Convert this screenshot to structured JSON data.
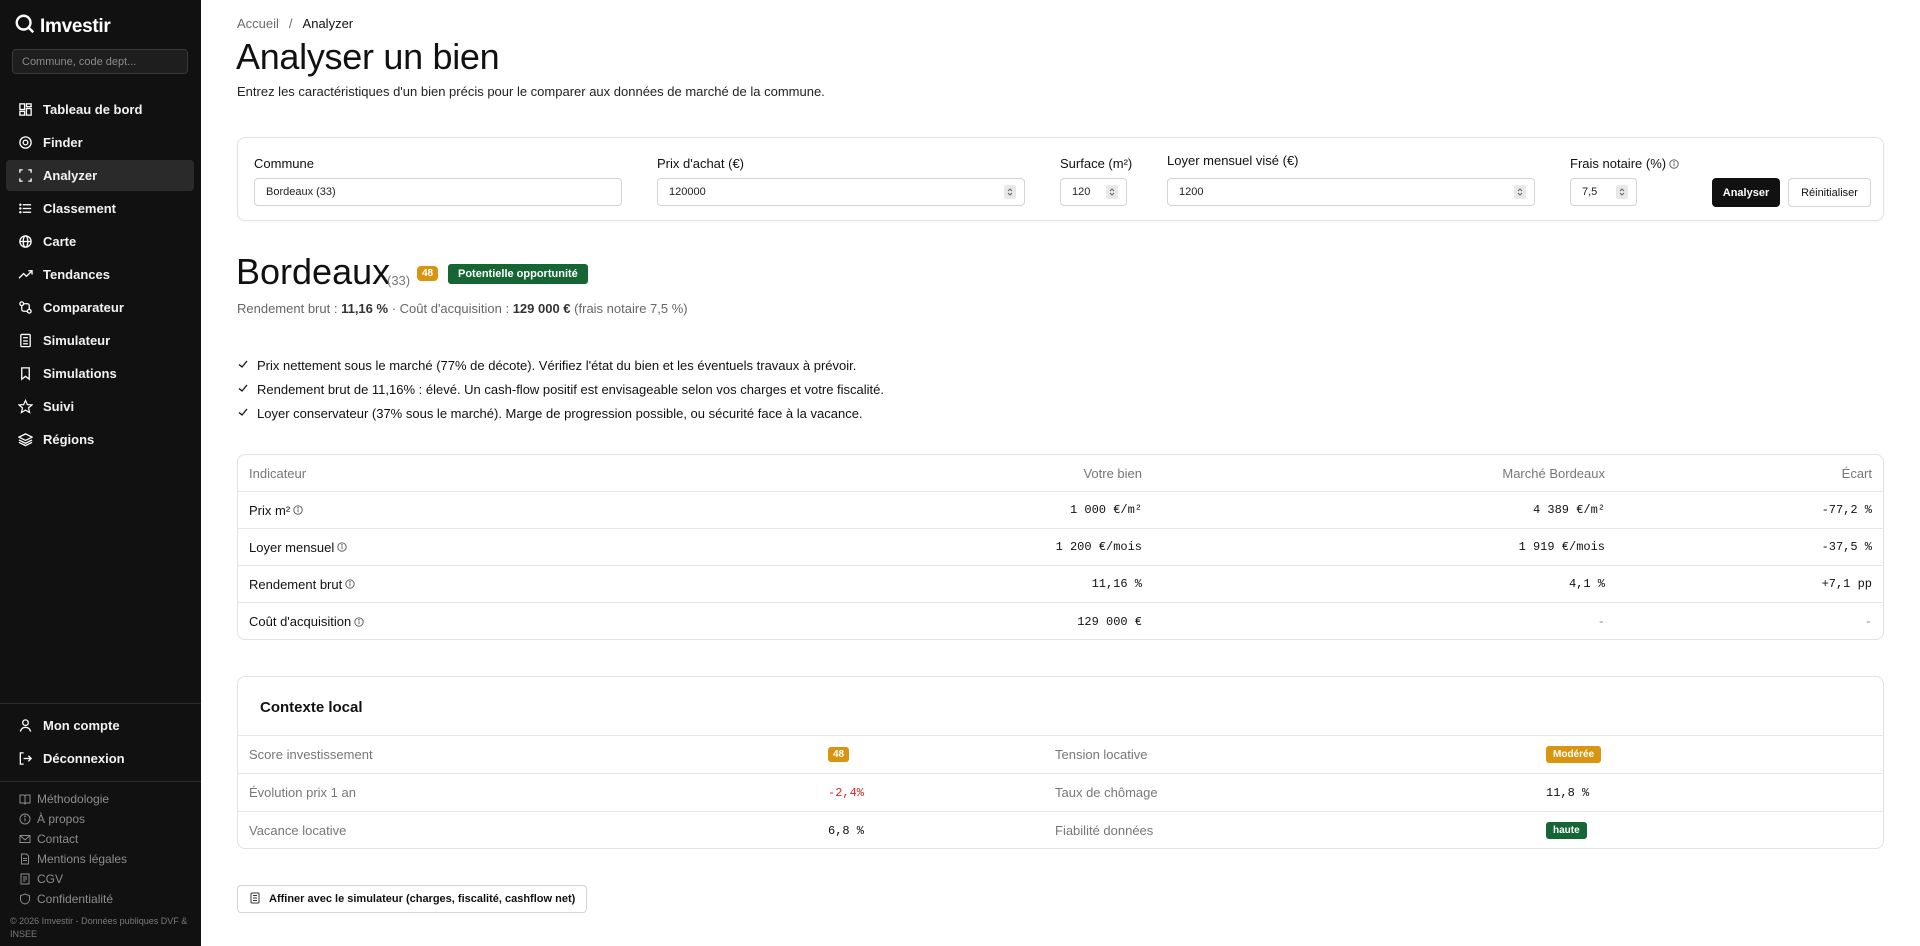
{
  "app": {
    "name": "Imvestir"
  },
  "sidebar": {
    "search_placeholder": "Commune, code dept...",
    "items": [
      {
        "label": "Tableau de bord",
        "icon": "dashboard-icon"
      },
      {
        "label": "Finder",
        "icon": "target-icon"
      },
      {
        "label": "Analyzer",
        "icon": "scan-icon"
      },
      {
        "label": "Classement",
        "icon": "list-icon"
      },
      {
        "label": "Carte",
        "icon": "globe-icon"
      },
      {
        "label": "Tendances",
        "icon": "trending-icon"
      },
      {
        "label": "Comparateur",
        "icon": "compare-icon"
      },
      {
        "label": "Simulateur",
        "icon": "calculator-icon"
      },
      {
        "label": "Simulations",
        "icon": "bookmark-icon"
      },
      {
        "label": "Suivi",
        "icon": "star-icon"
      },
      {
        "label": "Régions",
        "icon": "layers-icon"
      }
    ],
    "active_index": 2,
    "account_label": "Mon compte",
    "logout_label": "Déconnexion",
    "footer_links": [
      "Méthodologie",
      "À propos",
      "Contact",
      "Mentions légales",
      "CGV",
      "Confidentialité"
    ],
    "copyright": "© 2026 Imvestir - Données publiques DVF & INSEE"
  },
  "breadcrumb": {
    "home": "Accueil",
    "separator": "/",
    "current": "Analyzer"
  },
  "page": {
    "title": "Analyser un bien",
    "subtitle": "Entrez les caractéristiques d'un bien précis pour le comparer aux données de marché de la commune."
  },
  "form": {
    "commune_label": "Commune",
    "commune_value": "Bordeaux (33)",
    "prix_label": "Prix d'achat (€)",
    "prix_value": "120000",
    "surface_label": "Surface (m²)",
    "surface_value": "120",
    "loyer_label": "Loyer mensuel visé (€)",
    "loyer_value": "1200",
    "frais_label": "Frais notaire (%)",
    "frais_value": "7,5",
    "analyze_label": "Analyser",
    "reset_label": "Réinitialiser"
  },
  "result": {
    "city": "Bordeaux",
    "dept": "(33)",
    "score": "48",
    "badge": "Potentielle opportunité",
    "summary_prefix": "Rendement brut :",
    "summary_yield": "11,16 %",
    "summary_mid": "· Coût d'acquisition :",
    "summary_cost": "129 000 €",
    "summary_suffix": "(frais notaire 7,5 %)",
    "checks": [
      "Prix nettement sous le marché (77% de décote). Vérifiez l'état du bien et les éventuels travaux à prévoir.",
      "Rendement brut de 11,16% : élevé. Un cash-flow positif est envisageable selon vos charges et votre fiscalité.",
      "Loyer conservateur (37% sous le marché). Marge de progression possible, ou sécurité face à la vacance."
    ]
  },
  "comparison": {
    "headers": [
      "Indicateur",
      "Votre bien",
      "Marché Bordeaux",
      "Écart"
    ],
    "rows": [
      {
        "label": "Prix m²",
        "yours": "1 000 €/m²",
        "market": "4 389 €/m²",
        "gap": "-77,2 %"
      },
      {
        "label": "Loyer mensuel",
        "yours": "1 200 €/mois",
        "market": "1 919 €/mois",
        "gap": "-37,5 %"
      },
      {
        "label": "Rendement brut",
        "yours": "11,16 %",
        "market": "4,1 %",
        "gap": "+7,1 pp"
      },
      {
        "label": "Coût d'acquisition",
        "yours": "129 000 €",
        "market": "-",
        "gap": "-"
      }
    ]
  },
  "context": {
    "title": "Contexte local",
    "rows": [
      {
        "k1": "Score investissement",
        "v1": "48",
        "k2": "Tension locative",
        "v2": "Modérée"
      },
      {
        "k1": "Évolution prix 1 an",
        "v1": "-2,4%",
        "k2": "Taux de chômage",
        "v2": "11,8 %"
      },
      {
        "k1": "Vacance locative",
        "v1": "6,8 %",
        "k2": "Fiabilité données",
        "v2": "haute"
      }
    ],
    "colors": {
      "score": "#d99412",
      "tension": "#d99412",
      "reliability": "#166534",
      "negative": "#dc2626"
    }
  },
  "simulator_button": "Affiner avec le simulateur (charges, fiscalité, cashflow net)"
}
